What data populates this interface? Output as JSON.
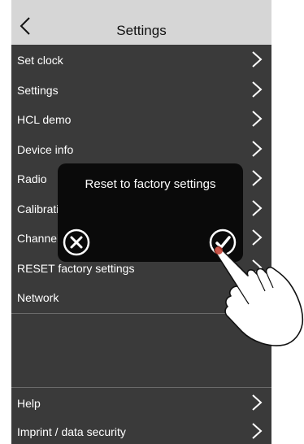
{
  "header": {
    "title": "Settings",
    "back_icon": "chevron-left-icon"
  },
  "menu": {
    "items": [
      {
        "label": "Set clock"
      },
      {
        "label": "Settings"
      },
      {
        "label": "HCL demo"
      },
      {
        "label": "Device info"
      },
      {
        "label": "Radio"
      },
      {
        "label": "Calibration"
      },
      {
        "label": "Channels"
      },
      {
        "label": "RESET factory settings"
      },
      {
        "label": "Network"
      }
    ],
    "bottom_items": [
      {
        "label": "Help"
      },
      {
        "label": "Imprint / data security"
      }
    ],
    "chevron_icon": "chevron-right-icon"
  },
  "dialog": {
    "title": "Reset to factory settings",
    "cancel_icon": "x-circle-icon",
    "confirm_icon": "check-circle-icon"
  },
  "colors": {
    "header_bg": "#d6d6d6",
    "list_bg": "#3a3a3a",
    "dialog_bg": "#0a0a0a",
    "tap_marker": "#c0392b"
  }
}
